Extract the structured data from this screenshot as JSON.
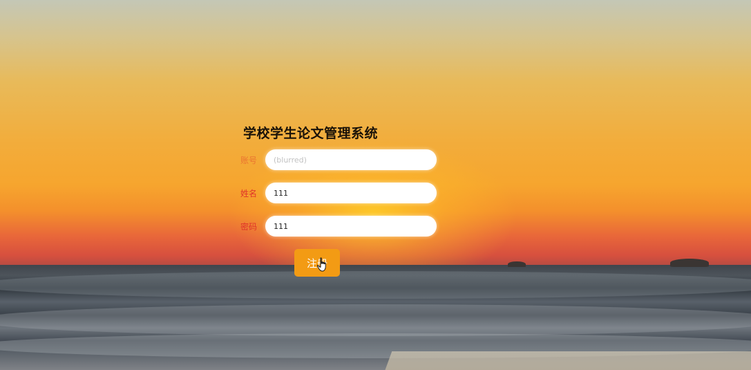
{
  "form": {
    "title": "学校学生论文管理系统",
    "fields": [
      {
        "label": "账号",
        "value": "(blurred)"
      },
      {
        "label": "姓名",
        "value": "111"
      },
      {
        "label": "密码",
        "value": "111"
      }
    ],
    "register_label": "注册"
  },
  "icons": {
    "cursor": "hand-pointer-icon"
  },
  "colors": {
    "label": "#e0342a",
    "button": "#f39b14",
    "title": "#1a1208"
  }
}
